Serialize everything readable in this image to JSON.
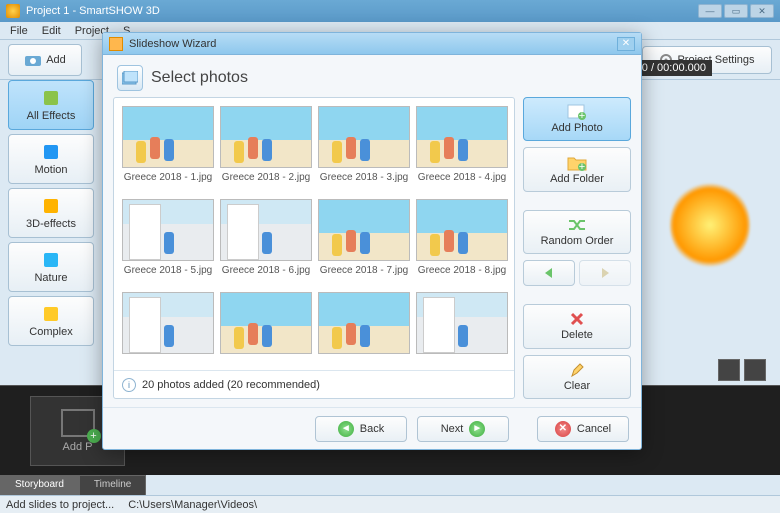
{
  "app": {
    "title": "Project 1 - SmartSHOW 3D"
  },
  "winbtns": {
    "min": "—",
    "max": "▭",
    "close": "✕"
  },
  "menu": [
    "File",
    "Edit",
    "Project",
    "S"
  ],
  "toolbar": {
    "add": "Add",
    "project_settings": "Project Settings"
  },
  "sidecats": [
    {
      "label": "All Effects",
      "active": true
    },
    {
      "label": "Motion",
      "active": false
    },
    {
      "label": "3D-effects",
      "active": false
    },
    {
      "label": "Nature",
      "active": false
    },
    {
      "label": "Complex",
      "active": false
    }
  ],
  "sidecat_colors": [
    "#8bc34a",
    "#2196f3",
    "#ffb300",
    "#29b6f6",
    "#ffca28"
  ],
  "timeline": {
    "counter": "00:00.000 / 00:00.000",
    "addslot": "Add P",
    "tabs": {
      "storyboard": "Storyboard",
      "timeline": "Timeline"
    }
  },
  "status": {
    "hint": "Add slides to project...",
    "path": "C:\\Users\\Manager\\Videos\\"
  },
  "modal": {
    "title": "Slideshow Wizard",
    "heading": "Select photos",
    "photos": [
      "Greece 2018 - 1.jpg",
      "Greece 2018 - 2.jpg",
      "Greece 2018 - 3.jpg",
      "Greece 2018 - 4.jpg",
      "Greece 2018 - 5.jpg",
      "Greece 2018 - 6.jpg",
      "Greece 2018 - 7.jpg",
      "Greece 2018 - 8.jpg",
      "",
      "",
      "",
      ""
    ],
    "thumb_variant": [
      "",
      "",
      "",
      "",
      "street",
      "street",
      "",
      "",
      "street",
      "",
      "",
      "street"
    ],
    "statusline": "20 photos added (20 recommended)",
    "side": {
      "add_photo": "Add Photo",
      "add_folder": "Add Folder",
      "random": "Random Order",
      "delete": "Delete",
      "clear": "Clear"
    },
    "footer": {
      "back": "Back",
      "next": "Next",
      "cancel": "Cancel"
    }
  }
}
